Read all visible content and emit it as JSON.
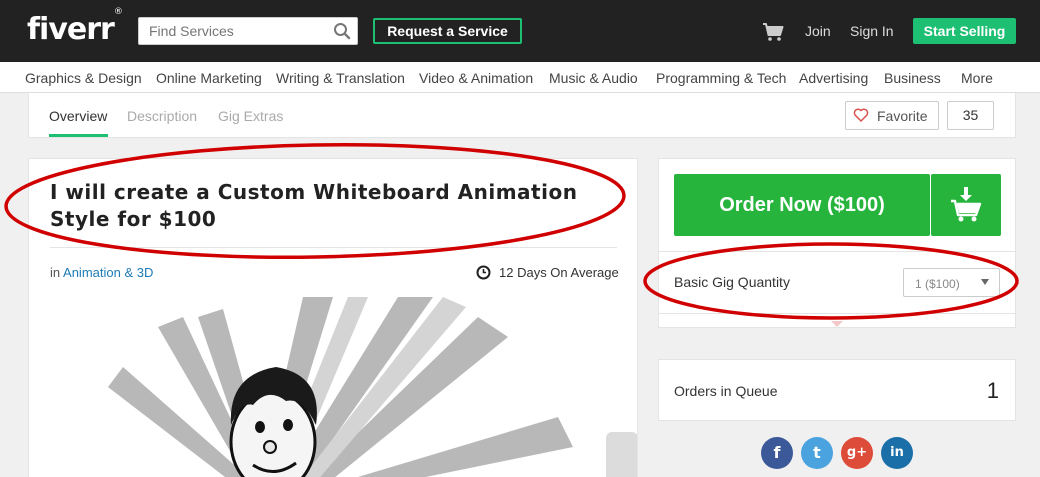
{
  "header": {
    "logo": "fiverr",
    "logo_mark": "®",
    "search_placeholder": "Find Services",
    "request_label": "Request a Service",
    "join_label": "Join",
    "signin_label": "Sign In",
    "sell_label": "Start Selling"
  },
  "categories": [
    "Graphics & Design",
    "Online Marketing",
    "Writing & Translation",
    "Video & Animation",
    "Music & Audio",
    "Programming & Tech",
    "Advertising",
    "Business",
    "More"
  ],
  "tabs": {
    "overview": "Overview",
    "description": "Description",
    "extras": "Gig Extras"
  },
  "favorite": {
    "label": "Favorite",
    "count": "35"
  },
  "gig": {
    "title": "I will create a Custom Whiteboard Animation Style for $100",
    "category_prefix": "in",
    "category": "Animation & 3D",
    "delivery": "12 Days On Average"
  },
  "order": {
    "button_label": "Order Now ($100)",
    "quantity_label": "Basic Gig Quantity",
    "quantity_value": "1 ($100)"
  },
  "queue": {
    "label": "Orders in Queue",
    "value": "1"
  },
  "social": {
    "facebook": "f",
    "twitter": "t",
    "googleplus": "g+",
    "linkedin": "in"
  },
  "colors": {
    "brand_green": "#1dbf73",
    "order_green": "#26b43c",
    "header_bg": "#222222",
    "annotation_red": "#d10000",
    "link_blue": "#1e7bb8"
  }
}
